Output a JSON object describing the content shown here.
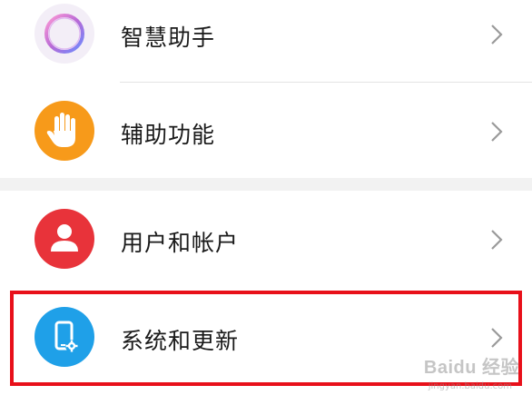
{
  "settings": {
    "items": [
      {
        "label": "智慧助手",
        "icon": "assistant-ring-icon",
        "icon_color": "#b86ad6"
      },
      {
        "label": "辅助功能",
        "icon": "hand-icon",
        "icon_color": "#f79a1a"
      },
      {
        "label": "用户和帐户",
        "icon": "user-icon",
        "icon_color": "#e8333a"
      },
      {
        "label": "系统和更新",
        "icon": "phone-gear-icon",
        "icon_color": "#1fa0e8"
      }
    ],
    "highlighted_item": "系统和更新",
    "highlight_color": "#e8101a"
  },
  "watermark": {
    "text": "Baidu 经验",
    "sub": "jingyan.baidu.com"
  }
}
